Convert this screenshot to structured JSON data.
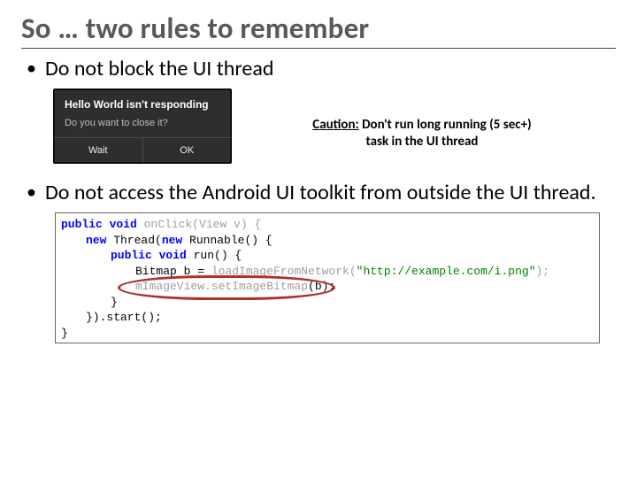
{
  "title": "So … two rules to remember",
  "bullets": {
    "b1": "Do not block the UI thread",
    "b2": "Do not access the Android UI toolkit from outside the UI thread."
  },
  "dialog": {
    "heading": "Hello World isn't responding",
    "question": "Do you want to close it?",
    "wait": "Wait",
    "ok": "OK"
  },
  "caution": {
    "label": "Caution:",
    "text": " Don't run long running (5 sec+) task in the UI thread"
  },
  "code": {
    "l1a": "public void",
    "l1b": " onClick(View v) {",
    "l2a": "new",
    "l2b": " Thread(",
    "l2c": "new",
    "l2d": " Runnable() {",
    "l3a": "public void",
    "l3b": " run() {",
    "l4a": "Bitmap b = ",
    "l4b": "loadImageFromNetwork(",
    "l4c": "\"http://example.com/i.png\"",
    "l4d": ");",
    "l5a": "mImageView.setImageBitmap",
    "l5b": "(b);",
    "l6": "}",
    "l7": "}).start();",
    "l8": "}"
  }
}
